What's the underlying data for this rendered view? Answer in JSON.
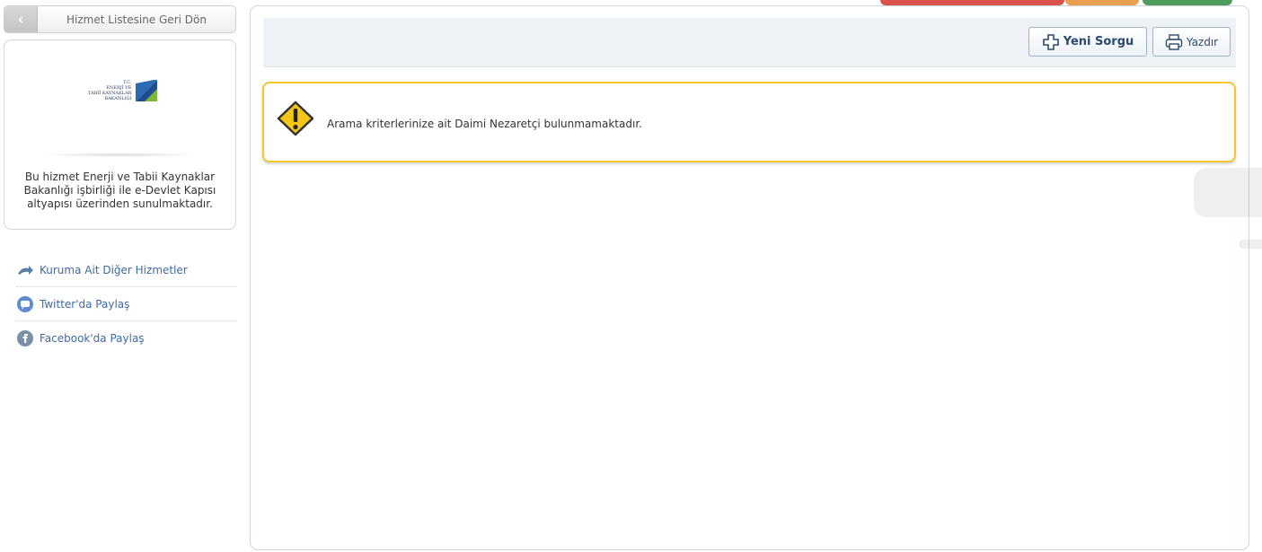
{
  "back_button": {
    "label": "Hizmet Listesine Geri Dön",
    "icon": "chevron-left-icon"
  },
  "info_card": {
    "logo": {
      "line1": "T.C.",
      "line2": "ENERJİ VE",
      "line3": "TABİİ KAYNAKLAR",
      "line4": "BAKANLIĞI"
    },
    "description": "Bu hizmet Enerji ve Tabii Kaynaklar Bakanlığı işbirliği ile e-Devlet Kapısı altyapısı üzerinden sunulmaktadır."
  },
  "side_links": [
    {
      "label": "Kuruma Ait Diğer Hizmetler",
      "icon": "redirect-arrow-icon"
    },
    {
      "label": "Twitter'da Paylaş",
      "icon": "twitter-icon"
    },
    {
      "label": "Facebook'da Paylaş",
      "icon": "facebook-icon"
    }
  ],
  "toolbar": {
    "new_query_label": "Yeni Sorgu",
    "print_label": "Yazdır"
  },
  "warning": {
    "message": "Arama kriterlerinize ait Daimi Nezaretçi bulunmamaktadır.",
    "icon": "warning-icon"
  },
  "colors": {
    "link_blue": "#3e6aa1",
    "warning_border": "#f3c531",
    "toolbar_bg": "#eef2f6"
  }
}
